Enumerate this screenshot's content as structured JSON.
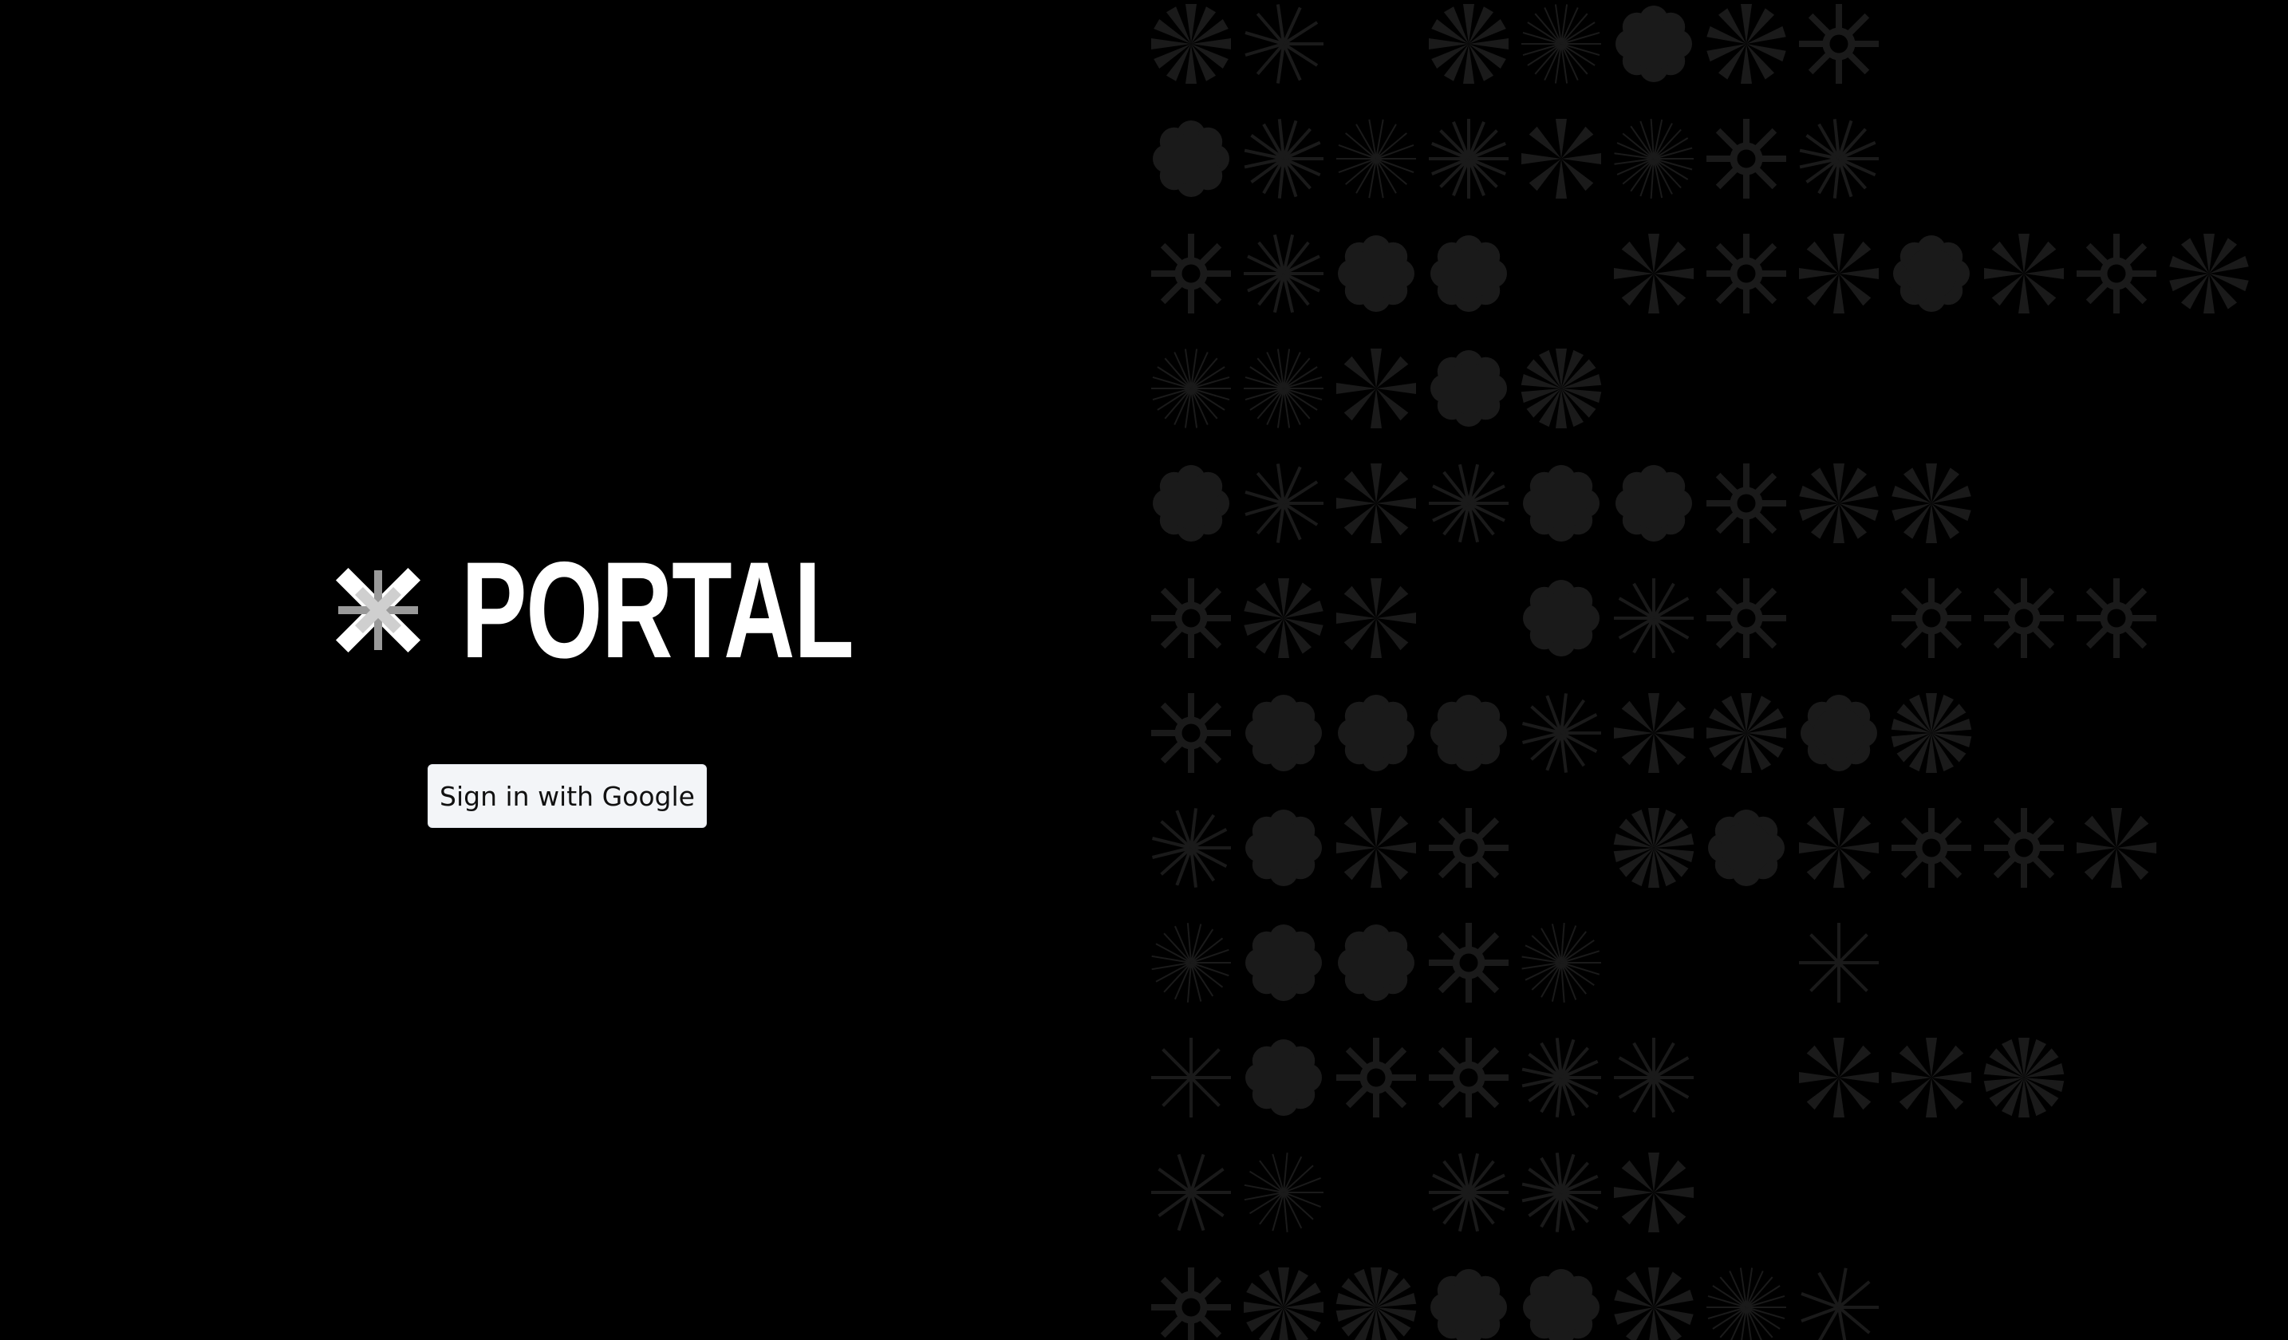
{
  "brand": {
    "name": "PORTAL",
    "logo_icon": "x-burst-logo-icon",
    "text_color": "#ffffff"
  },
  "auth": {
    "signin_label": "Sign in with Google",
    "button_bg": "#f3f5f8",
    "button_text_color": "#111111"
  },
  "background": {
    "page_color": "#000000",
    "pattern_color": "#1a1a1a",
    "pattern_icon": "asterisk-burst-icon"
  }
}
